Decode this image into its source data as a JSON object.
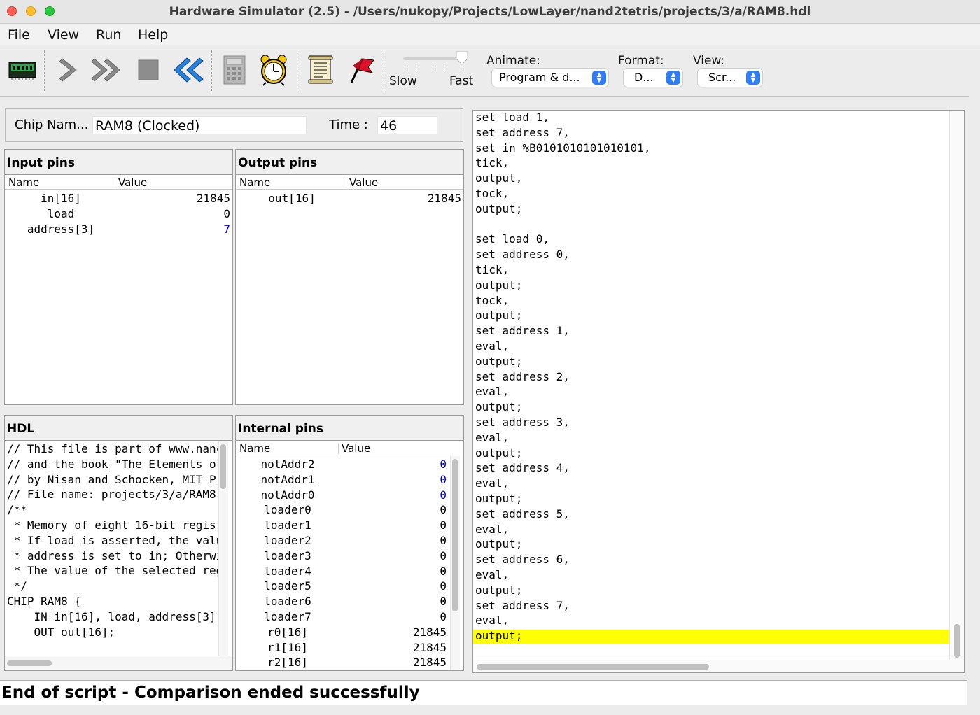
{
  "window": {
    "title": "Hardware Simulator (2.5) - /Users/nukopy/Projects/LowLayer/nand2tetris/projects/3/a/RAM8.hdl"
  },
  "menu": [
    "File",
    "View",
    "Run",
    "Help"
  ],
  "toolbar": {
    "speed_slow": "Slow",
    "speed_fast": "Fast",
    "animate_label": "Animate:",
    "animate_value": "Program & d...",
    "format_label": "Format:",
    "format_value": "D...",
    "view_label": "View:",
    "view_value": "Scr...",
    "icons": [
      "load-chip-icon",
      "single-step-icon",
      "run-icon",
      "stop-icon",
      "reset-icon",
      "calculator-icon",
      "clock-icon",
      "script-icon",
      "breakpoint-flag-icon"
    ]
  },
  "chip": {
    "name_label": "Chip Nam...",
    "name_value": "RAM8 (Clocked)",
    "time_label": "Time :",
    "time_value": "46"
  },
  "input_pins": {
    "title": "Input pins",
    "col_name": "Name",
    "col_value": "Value",
    "rows": [
      {
        "name": "in[16]",
        "value": "21845",
        "highlight": false
      },
      {
        "name": "load",
        "value": "0",
        "highlight": false
      },
      {
        "name": "address[3]",
        "value": "7",
        "highlight": true
      }
    ]
  },
  "output_pins": {
    "title": "Output pins",
    "col_name": "Name",
    "col_value": "Value",
    "rows": [
      {
        "name": "out[16]",
        "value": "21845"
      }
    ]
  },
  "hdl": {
    "title": "HDL",
    "lines": [
      "// This file is part of www.nanc",
      "// and the book \"The Elements of",
      "// by Nisan and Schocken, MIT Pr",
      "// File name: projects/3/a/RAM8.",
      "/**",
      " * Memory of eight 16-bit regist",
      " * If load is asserted, the valu",
      " * address is set to in; Otherwi",
      " * The value of the selected reg",
      " */",
      "CHIP RAM8 {",
      "    IN in[16], load, address[3];",
      "    OUT out[16];"
    ]
  },
  "internal_pins": {
    "title": "Internal pins",
    "col_name": "Name",
    "col_value": "Value",
    "rows": [
      {
        "name": "notAddr2",
        "value": "0",
        "highlight": true
      },
      {
        "name": "notAddr1",
        "value": "0",
        "highlight": true
      },
      {
        "name": "notAddr0",
        "value": "0",
        "highlight": true
      },
      {
        "name": "loader0",
        "value": "0",
        "highlight": false
      },
      {
        "name": "loader1",
        "value": "0",
        "highlight": false
      },
      {
        "name": "loader2",
        "value": "0",
        "highlight": false
      },
      {
        "name": "loader3",
        "value": "0",
        "highlight": false
      },
      {
        "name": "loader4",
        "value": "0",
        "highlight": false
      },
      {
        "name": "loader5",
        "value": "0",
        "highlight": false
      },
      {
        "name": "loader6",
        "value": "0",
        "highlight": false
      },
      {
        "name": "loader7",
        "value": "0",
        "highlight": false
      },
      {
        "name": "r0[16]",
        "value": "21845",
        "highlight": false
      },
      {
        "name": "r1[16]",
        "value": "21845",
        "highlight": false
      },
      {
        "name": "r2[16]",
        "value": "21845",
        "highlight": false
      }
    ]
  },
  "script": {
    "lines": [
      "set load 1,",
      "set address 7,",
      "set in %B0101010101010101,",
      "tick,",
      "output,",
      "tock,",
      "output;",
      "",
      "set load 0,",
      "set address 0,",
      "tick,",
      "output;",
      "tock,",
      "output;",
      "set address 1,",
      "eval,",
      "output;",
      "set address 2,",
      "eval,",
      "output;",
      "set address 3,",
      "eval,",
      "output;",
      "set address 4,",
      "eval,",
      "output;",
      "set address 5,",
      "eval,",
      "output;",
      "set address 6,",
      "eval,",
      "output;",
      "set address 7,",
      "eval,",
      "output;"
    ],
    "highlight_color": "#ffff00"
  },
  "status": {
    "message": "End of script - Comparison ended successfully"
  }
}
